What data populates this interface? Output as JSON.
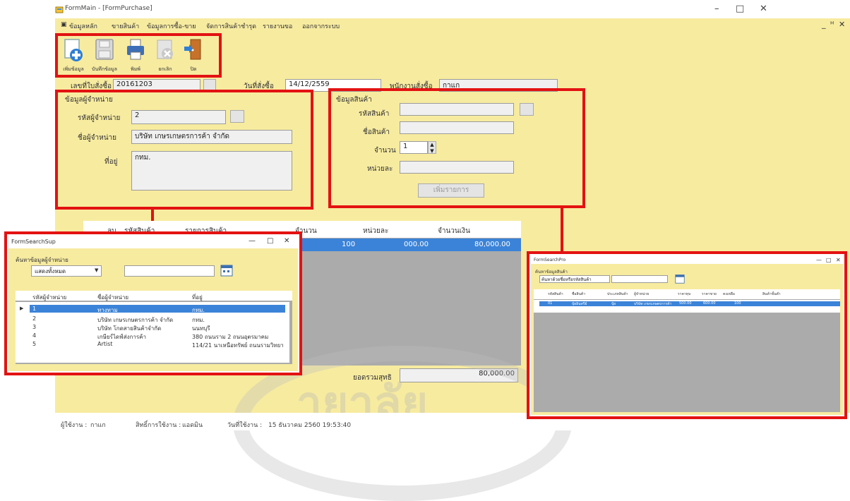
{
  "window": {
    "title": "FormMain - [FormPurchase]",
    "controls": [
      "–",
      "□",
      "✕"
    ],
    "mdi_controls": [
      "_",
      "ᴴ",
      "✕"
    ]
  },
  "menu": [
    "ข้อมูลหลัก",
    "ขายสินค้า",
    "ข้อมูลการซื้อ-ขาย",
    "จัดการสินค้าชำรุด",
    "รายงานขอ",
    "ออกจากระบบ"
  ],
  "toolbar": {
    "buttons": [
      {
        "label": "เพิ่มข้อมูล",
        "icon": "add-document-icon"
      },
      {
        "label": "บันทึกข้อมูล",
        "icon": "save-icon"
      },
      {
        "label": "พิมพ์",
        "icon": "printer-icon"
      },
      {
        "label": "ยกเลิก",
        "icon": "cancel-icon"
      },
      {
        "label": "ปิด",
        "icon": "exit-door-icon"
      }
    ]
  },
  "header": {
    "po_label": "เลขที่ใบสั่งซื้อ",
    "po_value": "20161203",
    "date_label": "วันที่สั่งซื้อ",
    "date_value": "14/12/2559",
    "clerk_label": "พนักงานสั่งซื้อ",
    "clerk_value": "กาแก"
  },
  "supplier": {
    "section": "ข้อมูลผู้จำหน่าย",
    "code_label": "รหัสผู้จำหน่าย",
    "code_value": "2",
    "name_label": "ชื่อผู้จำหน่าย",
    "name_value": "บริษัท เกษรเกษตรการค้า จำกัด",
    "addr_label": "ที่อยู่",
    "addr_value": "กทม."
  },
  "product": {
    "section": "ข้อมูลสินค้า",
    "code_label": "รหัสสินค้า",
    "name_label": "ชื่อสินค้า",
    "qty_label": "จำนวน",
    "qty_value": "1",
    "unit_label": "หน่วยละ",
    "add_button": "เพิ่มรายการ"
  },
  "grid": {
    "headers": [
      "ลบ",
      "รหัสสินค้า",
      "รายการสินค้า",
      "จำนวน",
      "หน่วยละ",
      "จำนวนเงิน"
    ],
    "row": {
      "qty": "100",
      "unit": "000.00",
      "amount": "80,000.00"
    }
  },
  "total": {
    "label": "ยอดรวมสุทธิ",
    "value": "80,000.00"
  },
  "statusbar": {
    "user_label": "ผู้ใช้งาน :",
    "user_value": "กาแก",
    "role_label": "สิทธิ์การใช้งาน :",
    "role_value": "แอดมิน",
    "date_label": "วันที่ใช้งาน :",
    "date_value": "15 ธันวาคม 2560 19:53:40"
  },
  "supplier_search": {
    "title": "FormSearchSup",
    "controls": [
      "—",
      "□",
      "✕"
    ],
    "search_label": "ค้นหาข้อมูลผู้จำหน่าย",
    "filter_value": "แสดงทั้งหมด",
    "headers": [
      "รหัสผู้จำหน่าย",
      "ชื่อผู้จำหน่าย",
      "ที่อยู่"
    ],
    "rows": [
      {
        "code": "1",
        "name": "ทางทาม",
        "addr": "กทม."
      },
      {
        "code": "2",
        "name": "บริษัท เกษรเกษตรการค้า จำกัด",
        "addr": "กทม."
      },
      {
        "code": "3",
        "name": "บริษัท โกดสายสินค้าจำกัด",
        "addr": "นนทบุรี"
      },
      {
        "code": "4",
        "name": "เกษียร์ไดฟ์ส่งการค้า",
        "addr": "380 ถนนราม 2 ถนนอุตรมาคม"
      },
      {
        "code": "5",
        "name": "Artist",
        "addr": "114/21 นาเหนือทรัพย์ ถนนรามวิทยา ถ."
      }
    ]
  },
  "product_search": {
    "title": "FormSearchPro",
    "controls": [
      "—",
      "□",
      "✕"
    ],
    "search_label": "ค้นหาข้อมูลสินค้า",
    "filter_value": "ค้นหาด้วยชื่อหรือรหัสสินค้า",
    "headers": [
      "รหัสสินค้า",
      "ชื่อสินค้า",
      "ประเภทสินค้า",
      "ผู้จำหน่าย",
      "ราคาทุน",
      "ราคาขาย",
      "คงเหลือ",
      "สินค้าขั้นต่ำ"
    ],
    "row": {
      "code": "01",
      "name": "ปุ๋ยอินทรีย์",
      "type": "ปุ๋ย",
      "supplier": "บริษัท เกษรเกษตรการค้า",
      "cost": "500.00",
      "price": "600.00",
      "qty": "100"
    }
  },
  "watermark": {
    "text": "ายาลัย"
  },
  "colors": {
    "form_bg": "#f7eba0",
    "highlight": "#e31212",
    "selection": "#3b83d8"
  }
}
